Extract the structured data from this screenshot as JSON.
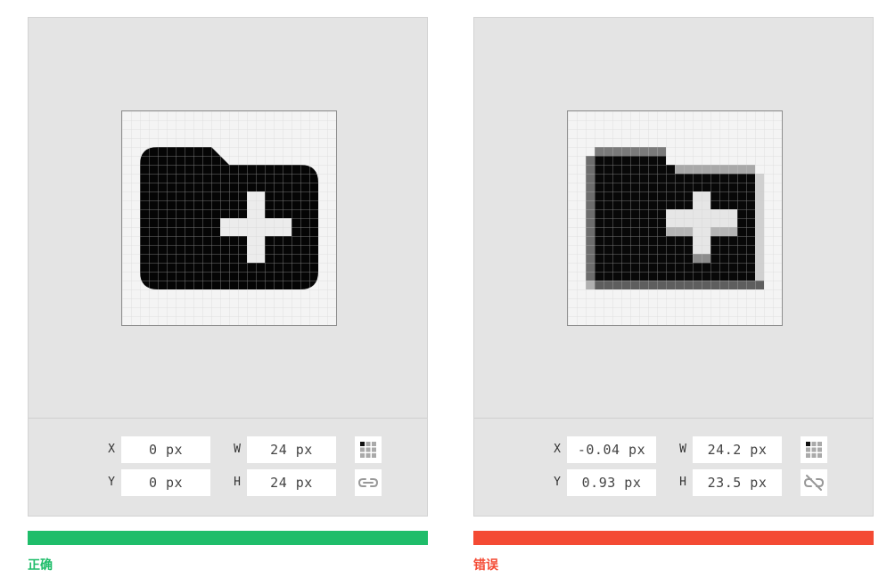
{
  "correct": {
    "x_label": "X",
    "x_value": "0 px",
    "y_label": "Y",
    "y_value": "0 px",
    "w_label": "W",
    "w_value": "24 px",
    "h_label": "H",
    "h_value": "24 px",
    "caption": "正确",
    "accent": "#1fbd6a",
    "icon": "create-new-folder-icon",
    "link_state": "linked"
  },
  "wrong": {
    "x_label": "X",
    "x_value": "-0.04 px",
    "y_label": "Y",
    "y_value": "0.93 px",
    "w_label": "W",
    "w_value": "24.2 px",
    "h_label": "H",
    "h_value": "23.5 px",
    "caption": "错误",
    "accent": "#f44a33",
    "icon": "create-new-folder-icon",
    "link_state": "unlinked"
  }
}
